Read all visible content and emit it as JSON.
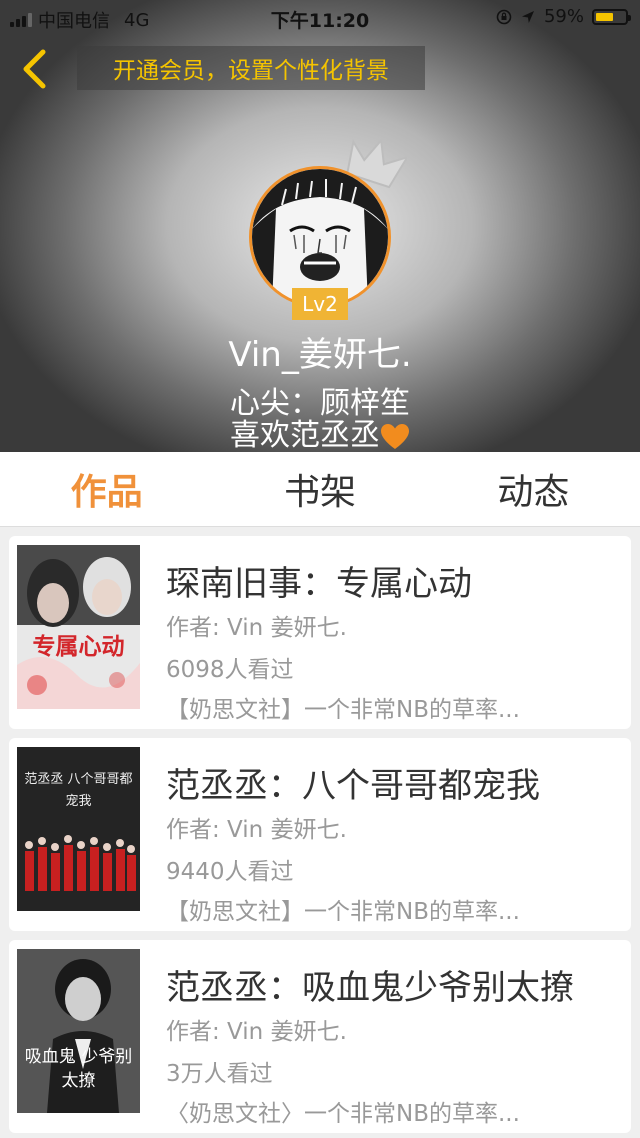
{
  "status_bar": {
    "carrier": "中国电信",
    "network": "4G",
    "time": "下午11:20",
    "battery_percent": "59%",
    "battery_level": 0.59
  },
  "header": {
    "vip_banner": "开通会员，设置个性化背景"
  },
  "profile": {
    "level": "Lv2",
    "username": "Vin_姜妍七.",
    "bio_line1": "心尖：顾梓笙",
    "bio_line2": "喜欢范丞丞"
  },
  "tabs": [
    {
      "label": "作品",
      "active": true
    },
    {
      "label": "书架",
      "active": false
    },
    {
      "label": "动态",
      "active": false
    }
  ],
  "books": [
    {
      "title": "琛南旧事：专属心动",
      "author": "作者: Vin  姜妍七.",
      "views": "6098人看过",
      "desc": "【奶思文社】一个非常NB的草率...",
      "cover_text": "专属心动"
    },
    {
      "title": "范丞丞：八个哥哥都宠我",
      "author": "作者: Vin  姜妍七.",
      "views": "9440人看过",
      "desc": "【奶思文社】一个非常NB的草率...",
      "cover_text": "范丞丞 八个哥哥都宠我"
    },
    {
      "title": "范丞丞：吸血鬼少爷别太撩",
      "author": "作者: Vin  姜妍七.",
      "views": "3万人看过",
      "desc": "〈奶思文社〉一个非常NB的草率...",
      "cover_text": "吸血鬼 少爷别太撩"
    }
  ],
  "colors": {
    "accent": "#f0913a",
    "vip_text": "#f5c400",
    "level_badge": "#f0b434"
  }
}
